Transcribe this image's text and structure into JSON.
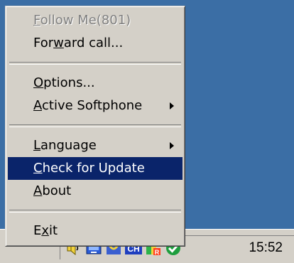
{
  "menu": {
    "follow_me": {
      "pre": "",
      "accel": "F",
      "post": "ollow Me(801)"
    },
    "forward_call": {
      "pre": "For",
      "accel": "w",
      "post": "ard call..."
    },
    "options": {
      "pre": "",
      "accel": "O",
      "post": "ptions..."
    },
    "active_softphone": {
      "pre": "",
      "accel": "A",
      "post": "ctive Softphone"
    },
    "language": {
      "pre": "",
      "accel": "L",
      "post": "anguage"
    },
    "check_update": {
      "pre": "",
      "accel": "C",
      "post": "heck for Update"
    },
    "about": {
      "pre": "",
      "accel": "A",
      "post": "bout"
    },
    "exit": {
      "pre": "E",
      "accel": "x",
      "post": "it"
    }
  },
  "taskbar": {
    "clock": "15:52",
    "tray_icons": [
      "speaker-icon",
      "network-icon",
      "softphone-icon",
      "language-indicator-icon",
      "antivirus-icon",
      "check-badge-icon"
    ],
    "language_indicator": "CH"
  },
  "colors": {
    "menu_bg": "#d4d0c8",
    "highlight": "#0a246a",
    "desktop": "#3b6ea5"
  }
}
